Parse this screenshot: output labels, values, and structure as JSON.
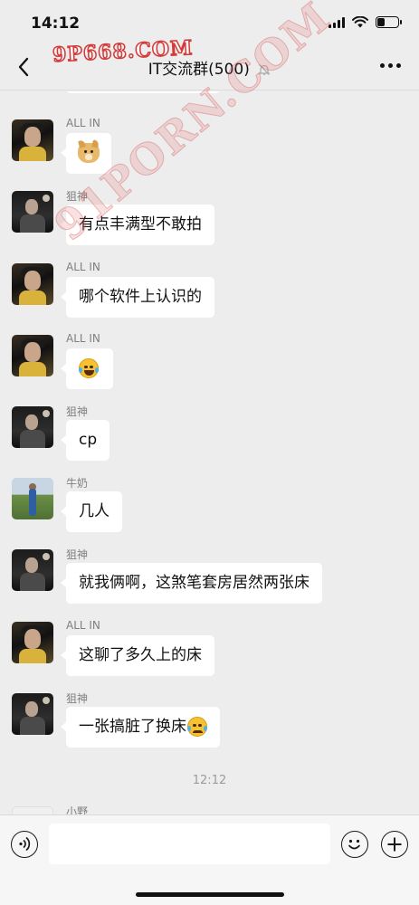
{
  "status_bar": {
    "time": "14:12",
    "icons": [
      "signal-icon",
      "wifi-icon",
      "battery-icon"
    ],
    "battery_level": 0.35
  },
  "header": {
    "title": "IT交流群(500)",
    "icons": [
      "back-icon",
      "mute-icon",
      "more-icon"
    ]
  },
  "watermarks": {
    "logo": "9P668.COM",
    "diagonal": "91PORN.COM"
  },
  "messages": [
    {
      "sender": "ALL IN",
      "avatar": "allin",
      "emoji": "doge"
    },
    {
      "sender": "狙神",
      "avatar": "jujshen",
      "text": "有点丰满型不敢拍"
    },
    {
      "sender": "ALL IN",
      "avatar": "allin",
      "text": "哪个软件上认识的"
    },
    {
      "sender": "ALL IN",
      "avatar": "allin",
      "emoji": "tears-of-joy"
    },
    {
      "sender": "狙神",
      "avatar": "jujshen",
      "text": "cp"
    },
    {
      "sender": "牛奶",
      "avatar": "milk",
      "text": "几人"
    },
    {
      "sender": "狙神",
      "avatar": "jujshen",
      "text": "就我俩啊，这煞笔套房居然两张床"
    },
    {
      "sender": "ALL IN",
      "avatar": "allin",
      "text": "这聊了多久上的床"
    },
    {
      "sender": "狙神",
      "avatar": "jujshen",
      "text": "一张搞脏了换床",
      "emoji": "crying-face"
    }
  ],
  "timestamp": "12:12",
  "partial_sender": "小野",
  "input_bar": {
    "placeholder": "",
    "icons": [
      "voice-icon",
      "emoji-icon",
      "plus-icon"
    ]
  },
  "colors": {
    "background": "#ededed",
    "bubble": "#ffffff",
    "sender_name": "#7f7f7f",
    "watermark_red": "#d43a3a"
  }
}
